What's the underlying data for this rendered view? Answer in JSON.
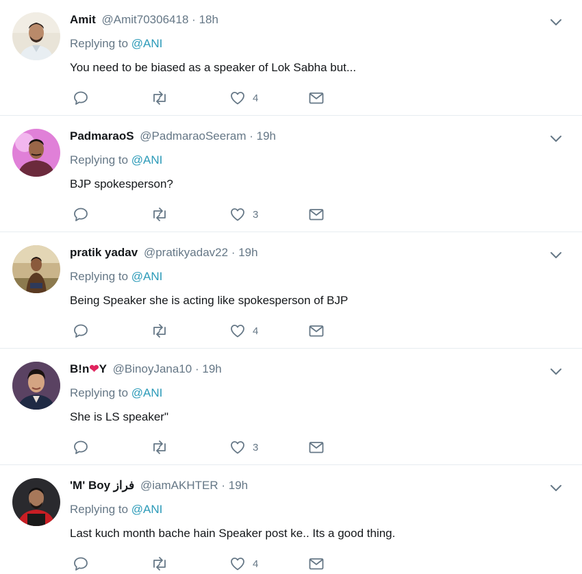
{
  "replying_prefix": "Replying to",
  "colors": {
    "name": "#14171a",
    "meta": "#657786",
    "mention": "#2b9ab8",
    "divider": "#e6ecf0"
  },
  "tweets": [
    {
      "name": "Amit",
      "handle": "@Amit70306418",
      "time": "18h",
      "replying_to": "@ANI",
      "text": "You need to be biased as a speaker of Lok Sabha but...",
      "likes": "4",
      "avatar": "man-in-white-shirt"
    },
    {
      "name": "PadmaraoS",
      "handle": "@PadmaraoSeeram",
      "time": "19h",
      "replying_to": "@ANI",
      "text": "BJP spokesperson?",
      "likes": "3",
      "avatar": "man-on-pink-background"
    },
    {
      "name": "pratik yadav",
      "handle": "@pratikyadav22",
      "time": "19h",
      "replying_to": "@ANI",
      "text": "Being Speaker she is acting like spokesperson of BJP",
      "likes": "4",
      "avatar": "man-sitting-outdoors"
    },
    {
      "name_prefix": "B!n",
      "name_emoji": "❤",
      "name_suffix": "Y",
      "handle": "@BinoyJana10",
      "time": "19h",
      "replying_to": "@ANI",
      "text": "She is LS speaker\"",
      "likes": "3",
      "avatar": "man-portrait-vintage"
    },
    {
      "name": "'M' Boy فراز",
      "handle": "@iamAKHTER",
      "time": "19h",
      "replying_to": "@ANI",
      "text": "Last kuch month bache hain Speaker post ke.. Its a good thing.",
      "likes": "4",
      "avatar": "man-in-red-shirt"
    }
  ]
}
